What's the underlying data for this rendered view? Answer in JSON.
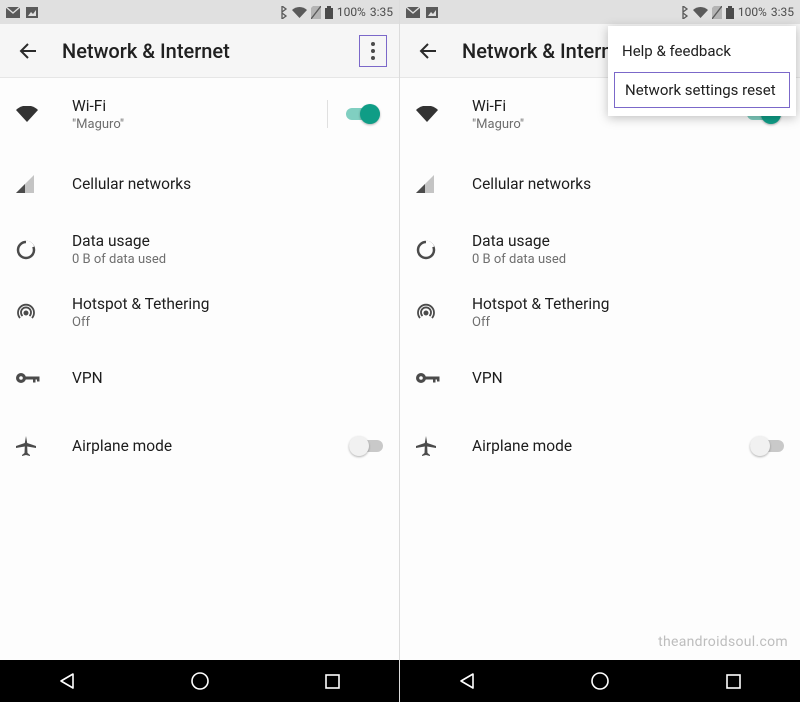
{
  "status": {
    "battery_pct": "100%",
    "time": "3:35"
  },
  "appbar": {
    "title": "Network & Internet"
  },
  "rows": {
    "wifi": {
      "title": "Wi-Fi",
      "sub": "\"Maguro\""
    },
    "cellular": {
      "title": "Cellular networks"
    },
    "data": {
      "title": "Data usage",
      "sub": "0 B of data used"
    },
    "hotspot": {
      "title": "Hotspot & Tethering",
      "sub": "Off"
    },
    "vpn": {
      "title": "VPN"
    },
    "airplane": {
      "title": "Airplane mode"
    }
  },
  "overflow": {
    "help": "Help & feedback",
    "reset": "Network settings reset"
  },
  "watermark": "theandroidsoul.com"
}
